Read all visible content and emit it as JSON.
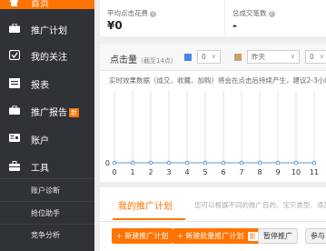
{
  "sidebar": {
    "items": [
      {
        "label": "首页",
        "icon": "home-icon"
      },
      {
        "label": "推广计划",
        "icon": "briefcase-icon"
      },
      {
        "label": "我的关注",
        "icon": "follow-icon"
      },
      {
        "label": "报表",
        "icon": "report-icon"
      },
      {
        "label": "推广报告",
        "badge": "新",
        "icon": "briefcase-icon"
      },
      {
        "label": "账户",
        "icon": "account-icon"
      },
      {
        "label": "工具",
        "icon": "toolbox-icon"
      }
    ],
    "tools_sub": [
      "账户诊断",
      "抢位助手",
      "竞争分析"
    ]
  },
  "stats": {
    "avg_cost_label": "平均点击花费",
    "avg_cost_value": "¥0",
    "total_deals_label": "总成交笔数",
    "total_deals_value": "-"
  },
  "chart_toolbar": {
    "metric": "点击量",
    "metric_note": "（截至14点）",
    "select1_value": "0",
    "select2_value": "昨天",
    "select3_value": "0",
    "colors": {
      "blue": "#4a86e8",
      "tan": "#c8a06b"
    }
  },
  "chart_hint": "实时效果数据（成交、收藏、加购）将会在点击后持续产生，建议2-3小时后",
  "chart_data": {
    "type": "line",
    "x": [
      0,
      1,
      2,
      3,
      4,
      5,
      6,
      7,
      8,
      9,
      10,
      11
    ],
    "series": [
      {
        "values": [
          0,
          0,
          0,
          0,
          0,
          0,
          0,
          0,
          0,
          0,
          0,
          0
        ]
      }
    ],
    "ytick": "0",
    "xlim": [
      0,
      11
    ],
    "grid": "vertical",
    "colors": {
      "line": "#5b9bd5",
      "grid": "#e3e3e3"
    }
  },
  "plan": {
    "tab_label": "我的推广计划",
    "tab_desc": "您可以根据不同的推广目的、宝贝类型、添加",
    "buttons": {
      "new_plan": "+ 新建推广计划",
      "batch_new": "+ 新建批量推广计划",
      "batch_badge": "新",
      "pause": "暂停推广",
      "join": "参与"
    }
  }
}
